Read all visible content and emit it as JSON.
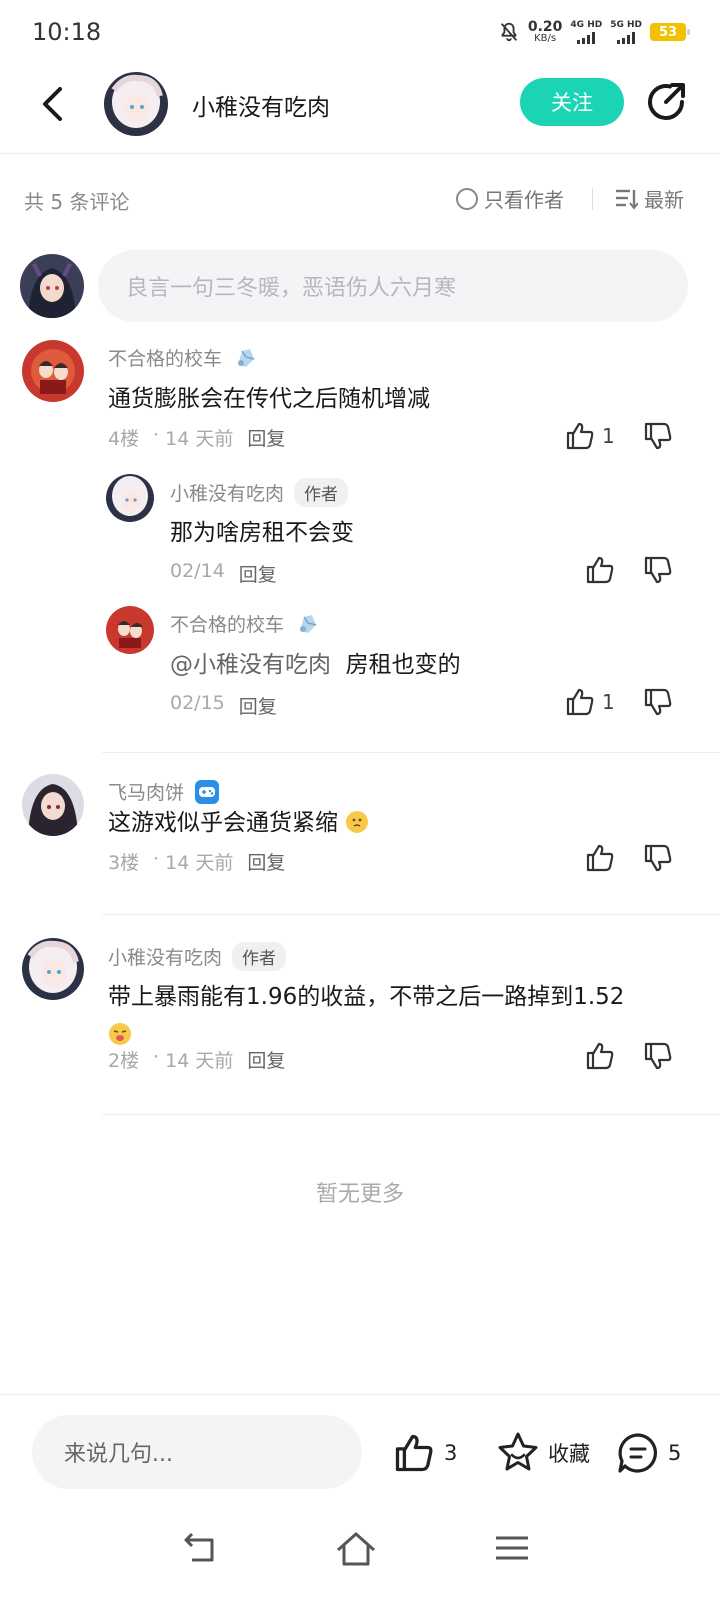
{
  "status": {
    "time": "10:18",
    "net_speed": "0.20",
    "net_unit": "KB/s",
    "sig1": "4G HD",
    "sig2": "5G HD",
    "battery": "53"
  },
  "header": {
    "author_name": "小稚没有吃肉",
    "follow_label": "关注"
  },
  "filter": {
    "count_label": "共 5 条评论",
    "author_only_label": "只看作者",
    "sort_label": "最新"
  },
  "composer": {
    "placeholder": "良言一句三冬暖，恶语伤人六月寒"
  },
  "comments": [
    {
      "user": "不合格的校车",
      "text": "通货膨胀会在传代之后随机增减",
      "floor": "4楼",
      "time": "14 天前",
      "reply": "回复",
      "likes": "1",
      "replies": [
        {
          "user": "小稚没有吃肉",
          "badge": "作者",
          "text": "那为啥房租不会变",
          "time": "02/14",
          "reply": "回复"
        },
        {
          "user": "不合格的校车",
          "mention": "@小稚没有吃肉",
          "text": "房租也变的",
          "time": "02/15",
          "reply": "回复",
          "likes": "1"
        }
      ]
    },
    {
      "user": "飞马肉饼",
      "text": "这游戏似乎会通货紧缩",
      "floor": "3楼",
      "time": "14 天前",
      "reply": "回复"
    },
    {
      "user": "小稚没有吃肉",
      "badge": "作者",
      "text": "带上暴雨能有1.96的收益，不带之后一路掉到1.52",
      "floor": "2楼",
      "time": "14 天前",
      "reply": "回复"
    }
  ],
  "no_more": "暂无更多",
  "bottom": {
    "input_placeholder": "来说几句...",
    "like_count": "3",
    "favorite_label": "收藏",
    "comment_count": "5"
  },
  "colors": {
    "accent": "#1bd4b4",
    "battery": "#f2c200"
  }
}
